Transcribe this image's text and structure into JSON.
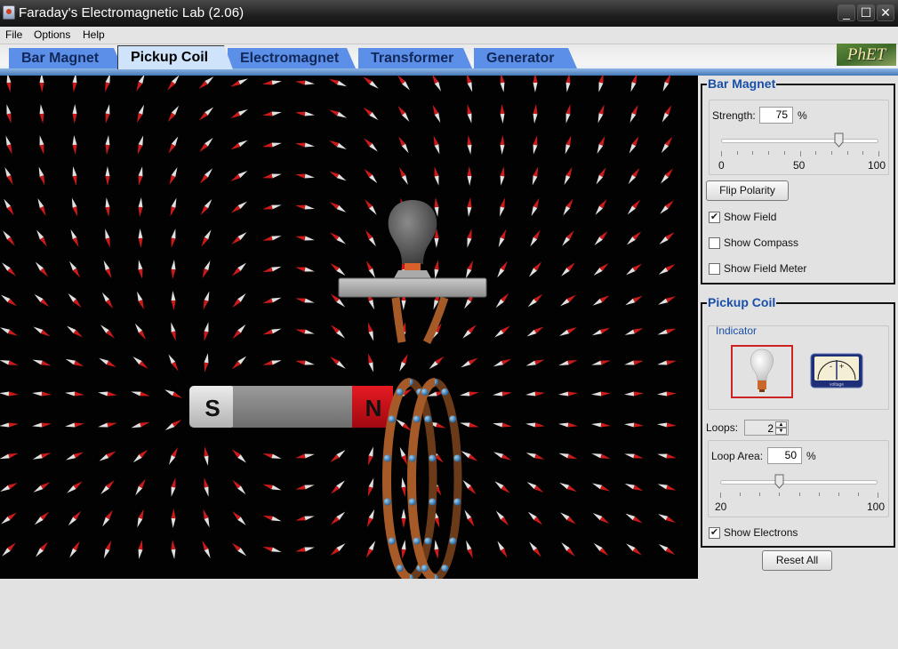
{
  "window": {
    "title": "Faraday's Electromagnetic Lab (2.06)",
    "controls": {
      "minimize": "_",
      "maximize": "☐",
      "close": "✕"
    }
  },
  "menu": {
    "items": [
      "File",
      "Options",
      "Help"
    ]
  },
  "tabs": [
    {
      "label": "Bar Magnet",
      "active": false
    },
    {
      "label": "Pickup Coil",
      "active": true
    },
    {
      "label": "Electromagnet",
      "active": false
    },
    {
      "label": "Transformer",
      "active": false
    },
    {
      "label": "Generator",
      "active": false
    }
  ],
  "logo": {
    "text": "PhET"
  },
  "scene": {
    "magnet": {
      "south_label": "S",
      "north_label": "N",
      "colors": {
        "south": "#d8d8d8",
        "body": "#8c8c8c",
        "north": "#d0101a"
      }
    },
    "bulb": {
      "lit": false
    },
    "coil": {
      "loops": 2,
      "color": "#a55a28",
      "electron_color": "#4a90c8"
    },
    "field": {
      "needle_north": "#cc1a1a",
      "needle_south": "#e0e0e0"
    }
  },
  "bar_magnet_panel": {
    "title": "Bar Magnet",
    "strength_label": "Strength:",
    "strength_value": "75",
    "strength_unit": "%",
    "strength_slider": {
      "min": 0,
      "max": 100,
      "value": 75,
      "tick_labels": [
        "0",
        "50",
        "100"
      ]
    },
    "flip_polarity": "Flip Polarity",
    "checkboxes": [
      {
        "label": "Show Field",
        "checked": true
      },
      {
        "label": "Show Compass",
        "checked": false
      },
      {
        "label": "Show Field Meter",
        "checked": false
      }
    ]
  },
  "pickup_coil_panel": {
    "title": "Pickup Coil",
    "indicator_label": "Indicator",
    "indicator_options": [
      {
        "name": "lightbulb",
        "selected": true
      },
      {
        "name": "voltmeter",
        "selected": false,
        "caption": "voltage",
        "minus": "-",
        "plus": "+"
      }
    ],
    "loops_label": "Loops:",
    "loops_value": "2",
    "loop_area_label": "Loop Area:",
    "loop_area_value": "50",
    "loop_area_unit": "%",
    "loop_area_slider": {
      "min": 20,
      "max": 100,
      "value": 50,
      "tick_labels": [
        "20",
        "100"
      ]
    },
    "show_electrons": {
      "label": "Show Electrons",
      "checked": true
    }
  },
  "reset_all": "Reset All"
}
